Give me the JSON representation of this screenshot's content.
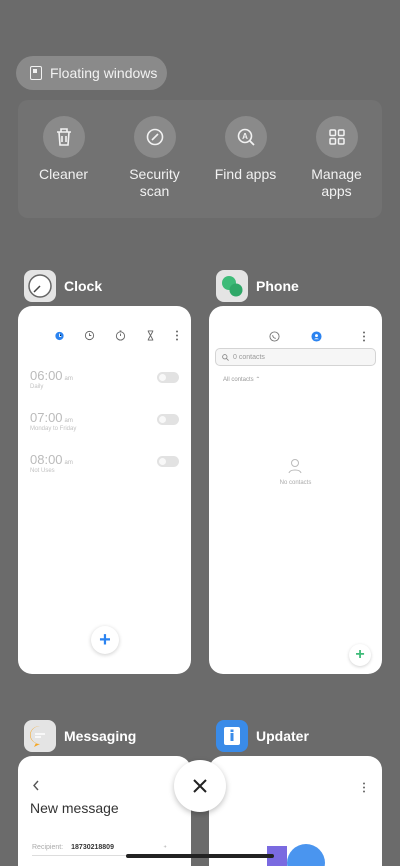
{
  "floating": {
    "label": "Floating windows"
  },
  "tools": [
    {
      "label": "Cleaner",
      "icon": "trash-icon"
    },
    {
      "label": "Security scan",
      "icon": "security-scan-icon"
    },
    {
      "label": "Find apps",
      "icon": "find-apps-icon"
    },
    {
      "label": "Manage apps",
      "icon": "grid-icon"
    }
  ],
  "apps": {
    "clock": {
      "title": "Clock",
      "alarms": [
        {
          "time": "06:00",
          "ampm": "am",
          "sub": "Daily"
        },
        {
          "time": "07:00",
          "ampm": "am",
          "sub": "Monday to Friday"
        },
        {
          "time": "08:00",
          "ampm": "am",
          "sub": "Not Uses"
        }
      ],
      "add": "+"
    },
    "phone": {
      "title": "Phone",
      "search_placeholder": "0 contacts",
      "filter": "All contacts",
      "empty": "No contacts",
      "add": "+"
    },
    "messaging": {
      "title": "Messaging",
      "heading": "New message",
      "recipient_label": "Recipient:",
      "recipient_value": "18730218809"
    },
    "updater": {
      "title": "Updater"
    }
  },
  "colors": {
    "accent": "#2b83f0",
    "green": "#3dbb78",
    "overlay": "#6b6b6b"
  }
}
